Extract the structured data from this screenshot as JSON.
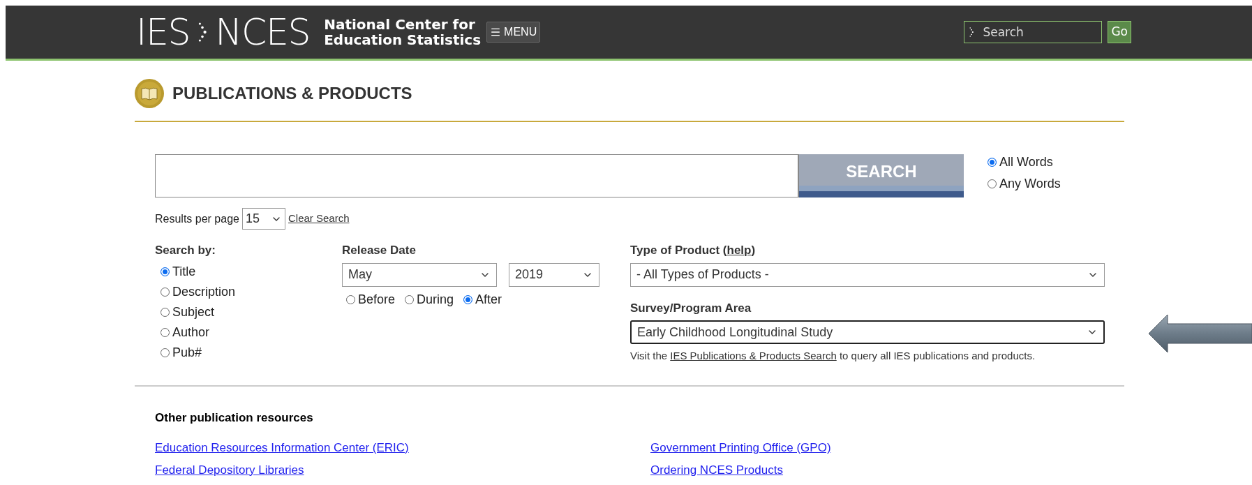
{
  "header": {
    "logo": {
      "left": "IES",
      "right": "NCES",
      "name_lines": [
        "National Center for",
        "Education Statistics"
      ]
    },
    "menu_button": {
      "label": "MENU"
    },
    "search": {
      "placeholder": "Search"
    },
    "go_button": "Go"
  },
  "page_title": "PUBLICATIONS & PRODUCTS",
  "search": {
    "button": "SEARCH",
    "match_options": [
      {
        "label": "All Words",
        "selected": true
      },
      {
        "label": "Any Words",
        "selected": false
      }
    ],
    "results_per_page": {
      "label": "Results per page",
      "value": "15"
    },
    "clear_search": "Clear Search"
  },
  "search_by": {
    "label": "Search by:",
    "options": [
      {
        "label": "Title",
        "selected": true
      },
      {
        "label": "Description",
        "selected": false
      },
      {
        "label": "Subject",
        "selected": false
      },
      {
        "label": "Author",
        "selected": false
      },
      {
        "label": "Pub#",
        "selected": false
      }
    ]
  },
  "release_date": {
    "label": "Release Date",
    "month": "May",
    "year": "2019",
    "options": [
      {
        "label": "Before",
        "selected": false
      },
      {
        "label": "During",
        "selected": false
      },
      {
        "label": "After",
        "selected": true
      }
    ]
  },
  "product_type": {
    "label_before": "Type of Product (",
    "help_link": "help",
    "label_after": ")",
    "value": "- All Types of Products -"
  },
  "survey_area": {
    "label": "Survey/Program Area",
    "value": "Early Childhood Longitudinal Study",
    "focused": true,
    "note_before": "Visit the",
    "note_link": "IES Publications & Products Search",
    "note_after": "to query all IES publications and products."
  },
  "other_resources": {
    "title": "Other publication resources",
    "links": [
      "Education Resources Information Center (ERIC)",
      "Government Printing Office (GPO)",
      "Federal Depository Libraries",
      "Ordering NCES Products"
    ]
  }
}
